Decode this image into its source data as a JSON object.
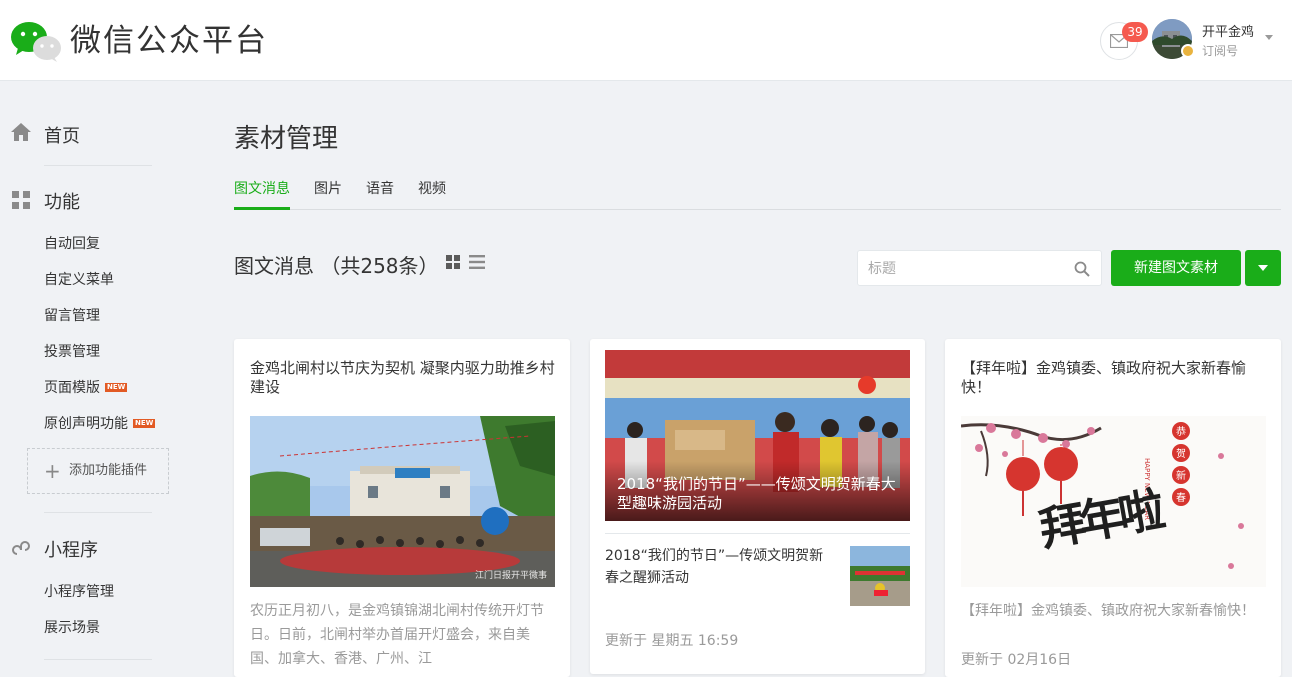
{
  "header": {
    "brand": "微信公众平台",
    "message_count": "39",
    "account_name": "开平金鸡",
    "account_type": "订阅号"
  },
  "sidebar": {
    "home": "首页",
    "function_section": "功能",
    "function_items": [
      {
        "label": "自动回复",
        "new": false
      },
      {
        "label": "自定义菜单",
        "new": false
      },
      {
        "label": "留言管理",
        "new": false
      },
      {
        "label": "投票管理",
        "new": false
      },
      {
        "label": "页面模版",
        "new": true
      },
      {
        "label": "原创声明功能",
        "new": true
      }
    ],
    "new_badge": "NEW",
    "add_plugin": "添加功能插件",
    "miniprogram_section": "小程序",
    "miniprogram_items": [
      "小程序管理",
      "展示场景"
    ]
  },
  "main": {
    "page_title": "素材管理",
    "tabs": [
      "图文消息",
      "图片",
      "语音",
      "视频"
    ],
    "active_tab": 0,
    "list_title": "图文消息 （共258条）",
    "search_placeholder": "标题",
    "new_button": "新建图文素材"
  },
  "cards": [
    {
      "title": "金鸡北闸村以节庆为契机  凝聚内驱力助推乡村建设",
      "image_watermark": "江门日报开平微事",
      "description": "农历正月初八，是金鸡镇锦湖北闸村传统开灯节日。日前，北闸村举办首届开灯盛会，来自美国、加拿大、香港、广州、江"
    },
    {
      "cover_caption": "2018“我们的节日”——传颂文明贺新春大型趣味游园活动",
      "sub_title": "2018“我们的节日”—传颂文明贺新春之醒狮活动",
      "time": "更新于 星期五 16:59"
    },
    {
      "title": "【拜年啦】金鸡镇委、镇政府祝大家新春愉快！",
      "image_text": "拜年啦",
      "image_badges": [
        "恭",
        "贺",
        "新",
        "春"
      ],
      "image_subtext": "HAPPY NEW YEAR",
      "description": "【拜年啦】金鸡镇委、镇政府祝大家新春愉快！",
      "time": "更新于 02月16日"
    }
  ]
}
